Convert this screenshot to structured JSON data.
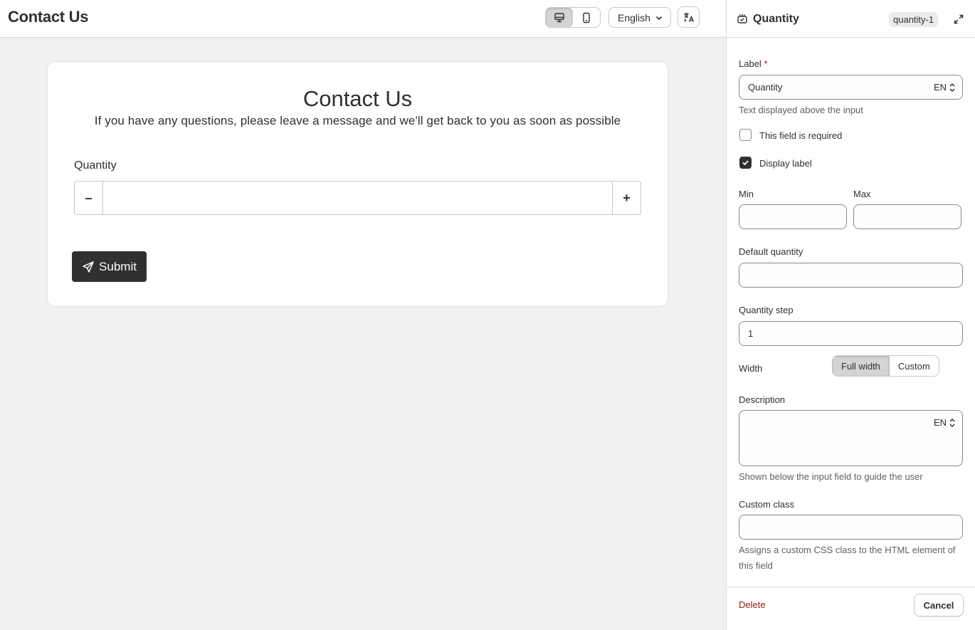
{
  "header": {
    "title": "Contact Us",
    "device_toggle": {
      "desktop_icon": "desktop-icon",
      "mobile_icon": "mobile-icon",
      "active": "desktop"
    },
    "language": "English",
    "translate_icon": "translate-icon"
  },
  "form": {
    "title": "Contact Us",
    "subtitle": "If you have any questions, please leave a message and we'll get back to you as soon as possible",
    "field_label": "Quantity",
    "minus": "–",
    "plus": "+",
    "value": "",
    "submit_label": "Submit",
    "submit_icon": "send-icon"
  },
  "panel": {
    "title": "Quantity",
    "id_badge": "quantity-1",
    "label_field": {
      "label": "Label",
      "required_mark": "*",
      "value": "Quantity",
      "lang": "EN",
      "help": "Text displayed above the input"
    },
    "required_checkbox": {
      "label": "This field is required",
      "checked": false
    },
    "display_label_checkbox": {
      "label": "Display label",
      "checked": true
    },
    "min": {
      "label": "Min",
      "value": ""
    },
    "max": {
      "label": "Max",
      "value": ""
    },
    "default_quantity": {
      "label": "Default quantity",
      "value": ""
    },
    "quantity_step": {
      "label": "Quantity step",
      "value": "1"
    },
    "width": {
      "label": "Width",
      "options": [
        "Full width",
        "Custom"
      ],
      "selected": "Full width"
    },
    "description": {
      "label": "Description",
      "value": "",
      "lang": "EN",
      "help": "Shown below the input field to guide the user"
    },
    "custom_class": {
      "label": "Custom class",
      "value": "",
      "help": "Assigns a custom CSS class to the HTML element of this field"
    },
    "delete_label": "Delete",
    "cancel_label": "Cancel"
  },
  "colors": {
    "dark": "#303030",
    "danger": "#8e1f0b",
    "canvas": "#f1f1f1"
  }
}
